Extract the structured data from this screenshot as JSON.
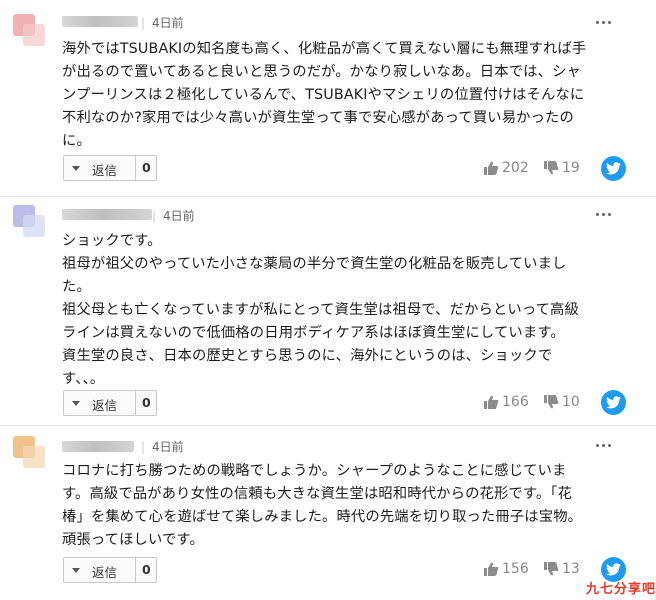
{
  "comments": [
    {
      "avatar_colors": [
        "#efb1b1",
        "#f4caca"
      ],
      "date": "4日前",
      "body": "海外ではTSUBAKIの知名度も高く、化粧品が高くて買えない層にも無理すれば手\nが出るので置いてあると良いと思うのだが。かなり寂しいなあ。日本では、シャ\nンプーリンスは２極化しているんで、TSUBAKIやマシェリの位置付けはそんなに\n不利なのか?家用では少々高いが資生堂って事で安心感があって買い易かったの\nに。",
      "reply_label": "返信",
      "reply_count": "0",
      "likes": "202",
      "dislikes": "19"
    },
    {
      "avatar_colors": [
        "#b9bde9",
        "#d6d9f3"
      ],
      "date": "4日前",
      "body": "ショックです。\n祖母が祖父のやっていた小さな薬局の半分で資生堂の化粧品を販売していまし\nた。\n祖父母とも亡くなっていますが私にとって資生堂は祖母で、だからといって高級\nラインは買えないので低価格の日用ボディケア系はほぼ資生堂にしています。\n資生堂の良さ、日本の歴史とすら思うのに、海外にというのは、ショックで\nす、、。",
      "reply_label": "返信",
      "reply_count": "0",
      "likes": "166",
      "dislikes": "10"
    },
    {
      "avatar_colors": [
        "#f0c38d",
        "#f5d8b4"
      ],
      "date": "4日前",
      "body": "コロナに打ち勝つための戦略でしょうか。シャープのようなことに感じていま\nす。高級で品があり女性の信頼も大きな資生堂は昭和時代からの花形です。「花\n椿」を集めて心を遊ばせて楽しみました。時代の先端を切り取った冊子は宝物。\n頑張ってほしいです。",
      "reply_label": "返信",
      "reply_count": "0",
      "likes": "156",
      "dislikes": "13"
    }
  ],
  "icons": {
    "like": "thumbs-up-icon",
    "dislike": "thumbs-down-icon",
    "share": "twitter-bird-icon",
    "more": "more-dots-icon",
    "reply_caret": "chevron-down-icon"
  },
  "colors": {
    "twitter": "#1d9bf0",
    "watermark_red": "#e23a2a",
    "watermark_blue": "#2d7ad6"
  },
  "watermark": {
    "text": "九七分享吧"
  }
}
